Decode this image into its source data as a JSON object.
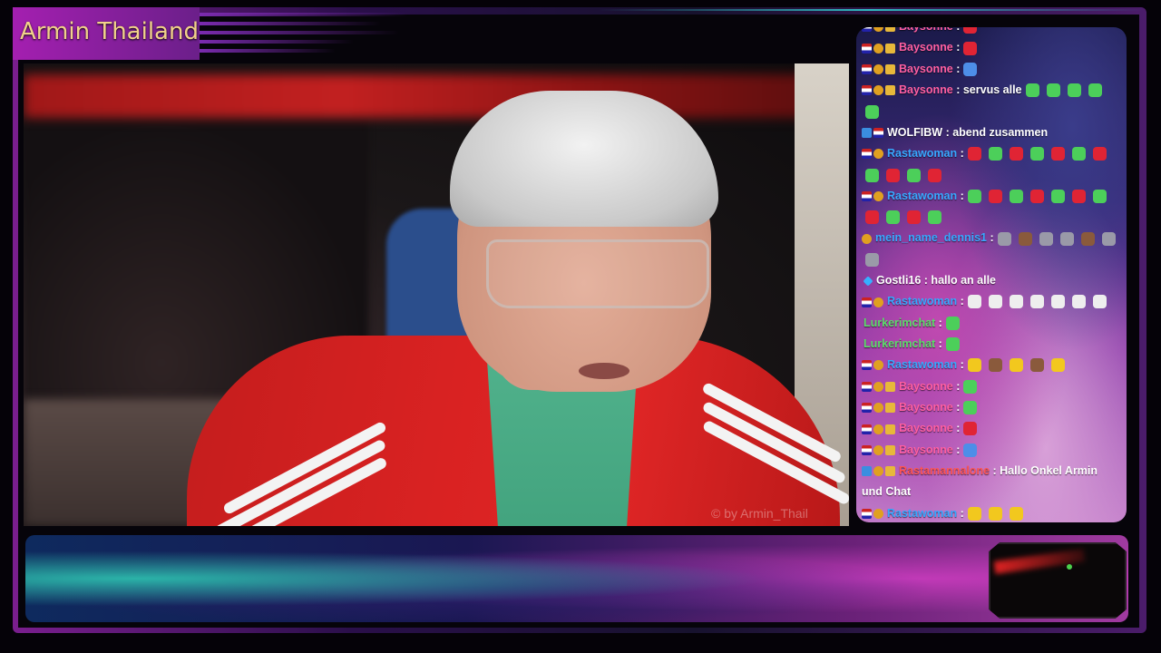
{
  "stream": {
    "title": "Armin Thailand",
    "watermark": "© by Armin_Thail"
  },
  "colors": {
    "title_text": "#f2d28a",
    "chat_username_blue": "#38a8ff",
    "chat_username_pink": "#ff5fa2",
    "chat_username_white": "#ffffff",
    "chat_username_green": "#5cdc6a",
    "chat_username_red": "#ff5555"
  },
  "chat": {
    "messages": [
      {
        "badges": [
          "flag-icon",
          "gold-badge-icon",
          "crown-badge-icon"
        ],
        "user": "Baysonne",
        "user_color": "#ff5fa2",
        "text": ":",
        "emotes": [
          "red-emote-icon"
        ]
      },
      {
        "badges": [
          "flag-icon",
          "gold-badge-icon",
          "crown-badge-icon"
        ],
        "user": "Baysonne",
        "user_color": "#ff5fa2",
        "text": ":",
        "emotes": [
          "red-emote-icon"
        ]
      },
      {
        "badges": [
          "flag-icon",
          "gold-badge-icon",
          "crown-badge-icon"
        ],
        "user": "Baysonne",
        "user_color": "#ff5fa2",
        "text": ":",
        "emotes": [
          "blue-emote-icon"
        ]
      },
      {
        "badges": [
          "flag-icon",
          "gold-badge-icon",
          "crown-badge-icon"
        ],
        "user": "Baysonne",
        "user_color": "#ff5fa2",
        "text": ": servus alle",
        "emotes": [
          "green-emote-icon",
          "green-emote-icon",
          "green-emote-icon",
          "green-emote-icon",
          "green-emote-icon"
        ]
      },
      {
        "badges": [
          "mod-badge-icon",
          "flag-icon"
        ],
        "user": "WOLFIBW",
        "user_color": "#ffffff",
        "text": ": abend zusammen",
        "emotes": []
      },
      {
        "badges": [
          "flag-icon",
          "gold-badge-icon"
        ],
        "user": "Rastawoman",
        "user_color": "#38a8ff",
        "text": ":",
        "emotes": [
          "red-emote-icon",
          "green-emote-icon",
          "red-emote-icon",
          "green-emote-icon",
          "red-emote-icon",
          "green-emote-icon",
          "red-emote-icon",
          "green-emote-icon",
          "red-emote-icon",
          "green-emote-icon",
          "red-emote-icon"
        ]
      },
      {
        "badges": [
          "flag-icon",
          "gold-badge-icon"
        ],
        "user": "Rastawoman",
        "user_color": "#38a8ff",
        "text": ":",
        "emotes": [
          "green-emote-icon",
          "red-emote-icon",
          "green-emote-icon",
          "red-emote-icon",
          "green-emote-icon",
          "red-emote-icon",
          "green-emote-icon",
          "red-emote-icon",
          "green-emote-icon",
          "red-emote-icon",
          "green-emote-icon"
        ]
      },
      {
        "badges": [
          "gold-badge-icon"
        ],
        "user": "mein_name_dennis1",
        "user_color": "#38a8ff",
        "text": ":",
        "emotes": [
          "grey-emote-icon",
          "brown-emote-icon",
          "grey-emote-icon",
          "grey-emote-icon",
          "brown-emote-icon",
          "grey-emote-icon",
          "grey-emote-icon"
        ]
      },
      {
        "badges": [
          "gem-badge-icon"
        ],
        "user": "Gostli16",
        "user_color": "#ffffff",
        "text": ": hallo an alle",
        "emotes": []
      },
      {
        "badges": [
          "flag-icon",
          "gold-badge-icon"
        ],
        "user": "Rastawoman",
        "user_color": "#38a8ff",
        "text": ":",
        "emotes": [
          "white-emote-icon",
          "white-emote-icon",
          "white-emote-icon",
          "white-emote-icon",
          "white-emote-icon",
          "white-emote-icon",
          "white-emote-icon"
        ]
      },
      {
        "badges": [],
        "user": "Lurkerimchat",
        "user_color": "#5cdc6a",
        "text": ":",
        "emotes": [
          "green-emote-icon"
        ]
      },
      {
        "badges": [],
        "user": "Lurkerimchat",
        "user_color": "#5cdc6a",
        "text": ":",
        "emotes": [
          "green-emote-icon"
        ]
      },
      {
        "badges": [
          "flag-icon",
          "gold-badge-icon"
        ],
        "user": "Rastawoman",
        "user_color": "#38a8ff",
        "text": ":",
        "emotes": [
          "yellow-emote-icon",
          "brown-emote-icon",
          "yellow-emote-icon",
          "brown-emote-icon",
          "yellow-emote-icon"
        ]
      },
      {
        "badges": [
          "flag-icon",
          "gold-badge-icon",
          "crown-badge-icon"
        ],
        "user": "Baysonne",
        "user_color": "#ff5fa2",
        "text": ":",
        "emotes": [
          "green-emote-icon"
        ]
      },
      {
        "badges": [
          "flag-icon",
          "gold-badge-icon",
          "crown-badge-icon"
        ],
        "user": "Baysonne",
        "user_color": "#ff5fa2",
        "text": ":",
        "emotes": [
          "green-emote-icon"
        ]
      },
      {
        "badges": [
          "flag-icon",
          "gold-badge-icon",
          "crown-badge-icon"
        ],
        "user": "Baysonne",
        "user_color": "#ff5fa2",
        "text": ":",
        "emotes": [
          "red-emote-icon"
        ]
      },
      {
        "badges": [
          "flag-icon",
          "gold-badge-icon",
          "crown-badge-icon"
        ],
        "user": "Baysonne",
        "user_color": "#ff5fa2",
        "text": ":",
        "emotes": [
          "blue-emote-icon"
        ]
      },
      {
        "badges": [
          "mod-badge-icon",
          "gold-badge-icon",
          "crown-badge-icon"
        ],
        "user": "Rastamannalone",
        "user_color": "#ff5555",
        "text": ": Hallo Onkel Armin und Chat",
        "emotes": []
      },
      {
        "badges": [
          "flag-icon",
          "gold-badge-icon"
        ],
        "user": "Rastawoman",
        "user_color": "#38a8ff",
        "text": ":",
        "emotes": [
          "yellow-emote-icon",
          "yellow-emote-icon",
          "yellow-emote-icon"
        ]
      }
    ]
  }
}
